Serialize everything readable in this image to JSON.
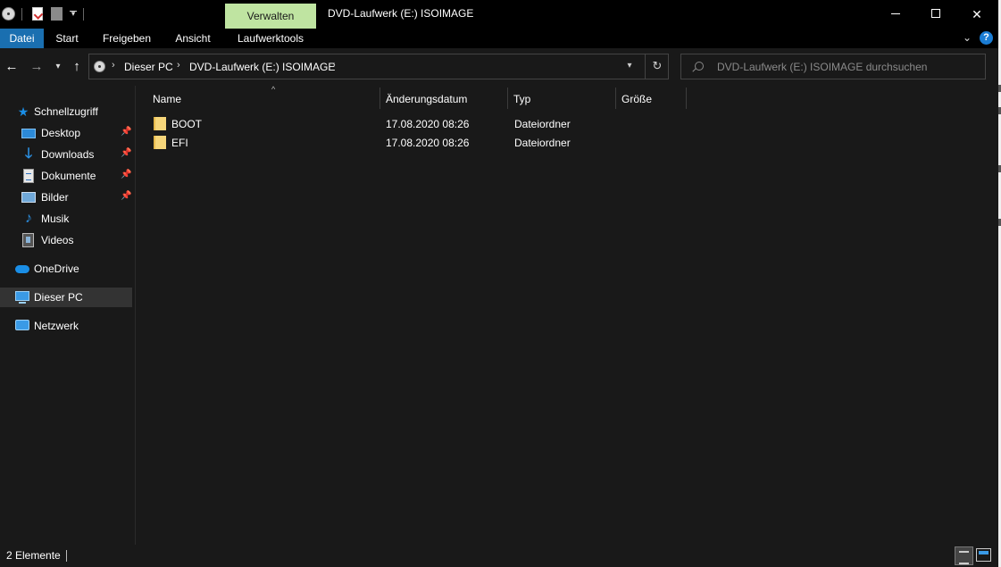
{
  "titlebar": {
    "context_tab": "Verwalten",
    "title": "DVD-Laufwerk (E:) ISOIMAGE"
  },
  "ribbon": {
    "tabs": [
      "Datei",
      "Start",
      "Freigeben",
      "Ansicht",
      "Laufwerktools"
    ],
    "help": "?"
  },
  "address": {
    "crumbs": [
      "Dieser PC",
      "DVD-Laufwerk (E:) ISOIMAGE"
    ]
  },
  "search": {
    "placeholder": "DVD-Laufwerk (E:) ISOIMAGE durchsuchen"
  },
  "sidebar": {
    "items": [
      {
        "label": "Schnellzugriff",
        "icon": "star-icon"
      },
      {
        "label": "Desktop",
        "icon": "desktop-icon",
        "pinned": true
      },
      {
        "label": "Downloads",
        "icon": "download-icon",
        "pinned": true
      },
      {
        "label": "Dokumente",
        "icon": "document-icon",
        "pinned": true
      },
      {
        "label": "Bilder",
        "icon": "pictures-icon",
        "pinned": true
      },
      {
        "label": "Musik",
        "icon": "music-icon"
      },
      {
        "label": "Videos",
        "icon": "video-icon"
      },
      {
        "label": "OneDrive",
        "icon": "cloud-icon"
      },
      {
        "label": "Dieser PC",
        "icon": "computer-icon",
        "selected": true
      },
      {
        "label": "Netzwerk",
        "icon": "network-icon"
      }
    ]
  },
  "columns": [
    "Name",
    "Änderungsdatum",
    "Typ",
    "Größe"
  ],
  "files": [
    {
      "name": "BOOT",
      "date": "17.08.2020 08:26",
      "type": "Dateiordner",
      "size": ""
    },
    {
      "name": "EFI",
      "date": "17.08.2020 08:26",
      "type": "Dateiordner",
      "size": ""
    }
  ],
  "status": {
    "count": "2 Elemente"
  },
  "colors": {
    "accent": "#1a6fb0",
    "context_tab": "#bfe4a1",
    "background": "#191919",
    "selected": "#333333"
  }
}
